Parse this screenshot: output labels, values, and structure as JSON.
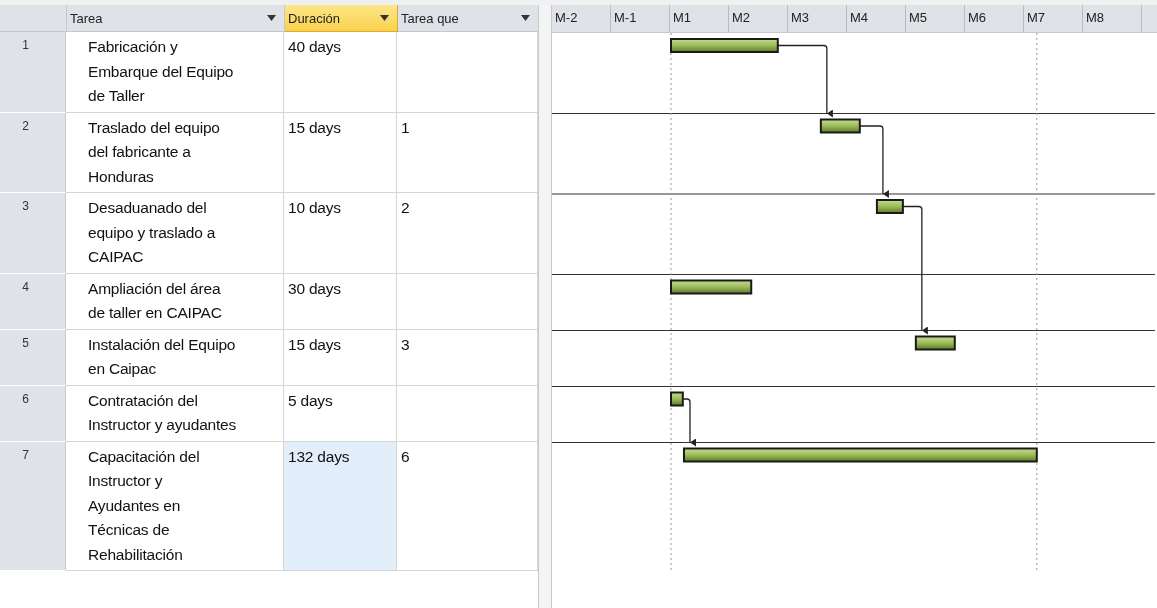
{
  "table": {
    "columns": [
      {
        "label": "Tarea",
        "selected": false
      },
      {
        "label": "Duración",
        "selected": true
      },
      {
        "label": "Tarea que",
        "selected": false
      }
    ],
    "rows": [
      {
        "number": "1",
        "task": "Fabricación y\nEmbarque del Equipo\nde Taller",
        "duration": "40 days",
        "duration_selected": false
      },
      {
        "number": "2",
        "task": "Traslado del equipo\ndel fabricante a\nHonduras",
        "duration": "15 days",
        "predecessor": "1",
        "duration_selected": false
      },
      {
        "number": "3",
        "task": "Desaduanado del\nequipo y traslado a\nCAIPAC",
        "duration": "10 days",
        "predecessor": "2",
        "duration_selected": false
      },
      {
        "number": "4",
        "task": "Ampliación del área\nde taller en CAIPAC",
        "duration": "30 days",
        "duration_selected": false
      },
      {
        "number": "5",
        "task": "Instalación del Equipo\nen Caipac",
        "duration": "15 days",
        "predecessor": "3",
        "duration_selected": false
      },
      {
        "number": "6",
        "task": "Contratación del\nInstructor y ayudantes",
        "duration": "5 days",
        "duration_selected": false
      },
      {
        "number": "7",
        "task": "Capacitación del\nInstructor y\nAyudantes en\nTécnicas de\nRehabilitación",
        "duration": "132 days",
        "predecessor": "6",
        "duration_selected": true
      }
    ]
  },
  "gantt": {
    "timescale": [
      "M-2",
      "M-1",
      "M1",
      "M2",
      "M3",
      "M4",
      "M5",
      "M6",
      "M7",
      "M8"
    ]
  }
}
